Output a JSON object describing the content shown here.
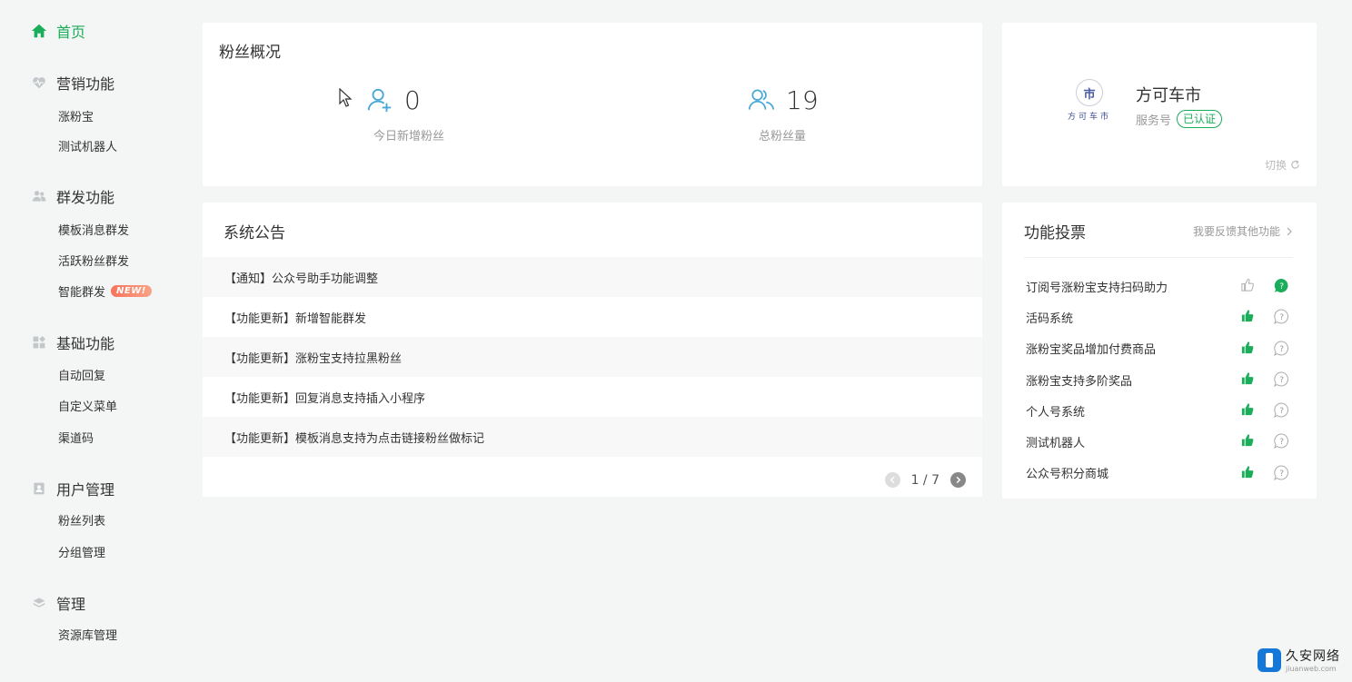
{
  "sidebar": {
    "home": "首页",
    "groups": [
      {
        "title": "营销功能",
        "items": [
          "涨粉宝",
          "测试机器人"
        ]
      },
      {
        "title": "群发功能",
        "items": [
          "模板消息群发",
          "活跃粉丝群发",
          "智能群发"
        ]
      },
      {
        "title": "基础功能",
        "items": [
          "自动回复",
          "自定义菜单",
          "渠道码"
        ]
      },
      {
        "title": "用户管理",
        "items": [
          "粉丝列表",
          "分组管理"
        ]
      },
      {
        "title": "管理",
        "items": [
          "资源库管理"
        ]
      }
    ],
    "new_badge": "NEW!"
  },
  "fans": {
    "title": "粉丝概况",
    "today_value": "0",
    "today_label": "今日新增粉丝",
    "total_value": "19",
    "total_label": "总粉丝量"
  },
  "account": {
    "logo_char": "市",
    "logo_text": "方可车市",
    "name": "方可车市",
    "type": "服务号",
    "verified": "已认证",
    "switch_label": "切换"
  },
  "notice": {
    "title": "系统公告",
    "items": [
      "【通知】公众号助手功能调整",
      "【功能更新】新增智能群发",
      "【功能更新】涨粉宝支持拉黑粉丝",
      "【功能更新】回复消息支持插入小程序",
      "【功能更新】模板消息支持为点击链接粉丝做标记"
    ],
    "pager": "1 / 7"
  },
  "vote": {
    "title": "功能投票",
    "more": "我要反馈其他功能",
    "items": [
      {
        "label": "订阅号涨粉宝支持扫码助力",
        "liked": false,
        "asked": true
      },
      {
        "label": "活码系统",
        "liked": true,
        "asked": false
      },
      {
        "label": "涨粉宝奖品增加付费商品",
        "liked": true,
        "asked": false
      },
      {
        "label": "涨粉宝支持多阶奖品",
        "liked": true,
        "asked": false
      },
      {
        "label": "个人号系统",
        "liked": true,
        "asked": false
      },
      {
        "label": "测试机器人",
        "liked": true,
        "asked": false
      },
      {
        "label": "公众号积分商城",
        "liked": true,
        "asked": false
      }
    ]
  },
  "watermark": {
    "name": "久安网络",
    "domain": "jiuanweb.com"
  },
  "colors": {
    "accent": "#1aad5a",
    "icon_blue": "#4aa8d8",
    "background": "#f4f5f5"
  }
}
